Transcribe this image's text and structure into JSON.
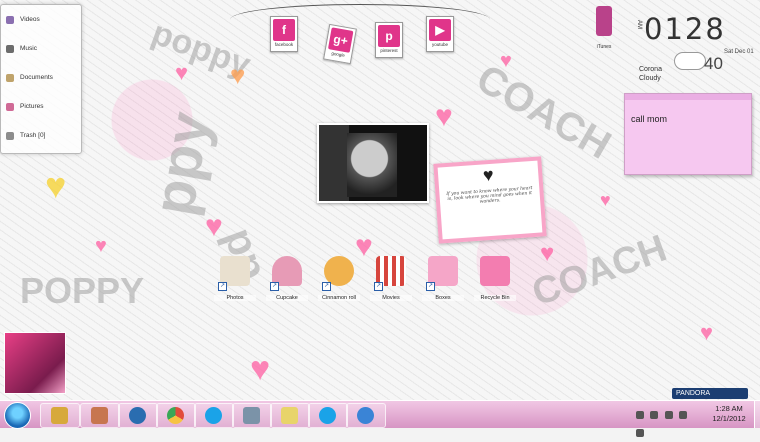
{
  "library": {
    "items": [
      {
        "label": "Videos",
        "icon": "videos-icon"
      },
      {
        "label": "Music",
        "icon": "music-icon"
      },
      {
        "label": "Documents",
        "icon": "documents-icon"
      },
      {
        "label": "Pictures",
        "icon": "pictures-icon"
      },
      {
        "label": "Trash [0]",
        "icon": "trash-icon"
      }
    ]
  },
  "social": [
    {
      "label": "facebook",
      "glyph": "f"
    },
    {
      "label": "google",
      "glyph": "g+"
    },
    {
      "label": "pinterest",
      "glyph": "p"
    },
    {
      "label": "youtube",
      "glyph": "▶"
    }
  ],
  "clock": {
    "time": "0128",
    "ampm": "AM",
    "date": "Sat Dec 01",
    "temp": "40",
    "city": "Corona",
    "condition": "Cloudy"
  },
  "ipod": {
    "label": "iTunes"
  },
  "note": {
    "text": "call mom"
  },
  "quote": {
    "heart": "♥",
    "text": "If you want to know where your heart is, look where you mind goes when it wanders."
  },
  "desktop_icons": [
    {
      "label": "Photos",
      "color": "#e9e0cf"
    },
    {
      "label": "Cupcake",
      "color": "#e79bb6"
    },
    {
      "label": "Cinnamon roll",
      "color": "#f0b24d"
    },
    {
      "label": "Movies",
      "color": "#d7453d"
    },
    {
      "label": "Boxes",
      "color": "#f5a6c8"
    },
    {
      "label": "Recycle Bin",
      "color": "#f37db0"
    }
  ],
  "pandora": {
    "label": "PANDORA"
  },
  "taskbar": {
    "apps": [
      {
        "name": "explorer",
        "color": "#d7a93b"
      },
      {
        "name": "folders",
        "color": "#c7764f"
      },
      {
        "name": "hp",
        "color": "#2a6db0"
      },
      {
        "name": "chrome",
        "color": "#e24b3b"
      },
      {
        "name": "skype",
        "color": "#1aa3e8"
      },
      {
        "name": "calculator",
        "color": "#7b93a8"
      },
      {
        "name": "sticky-notes",
        "color": "#e8d46a"
      },
      {
        "name": "skype2",
        "color": "#1aa3e8"
      },
      {
        "name": "itunes",
        "color": "#3a84d6"
      }
    ],
    "time": "1:28 AM",
    "date": "12/1/2012"
  }
}
